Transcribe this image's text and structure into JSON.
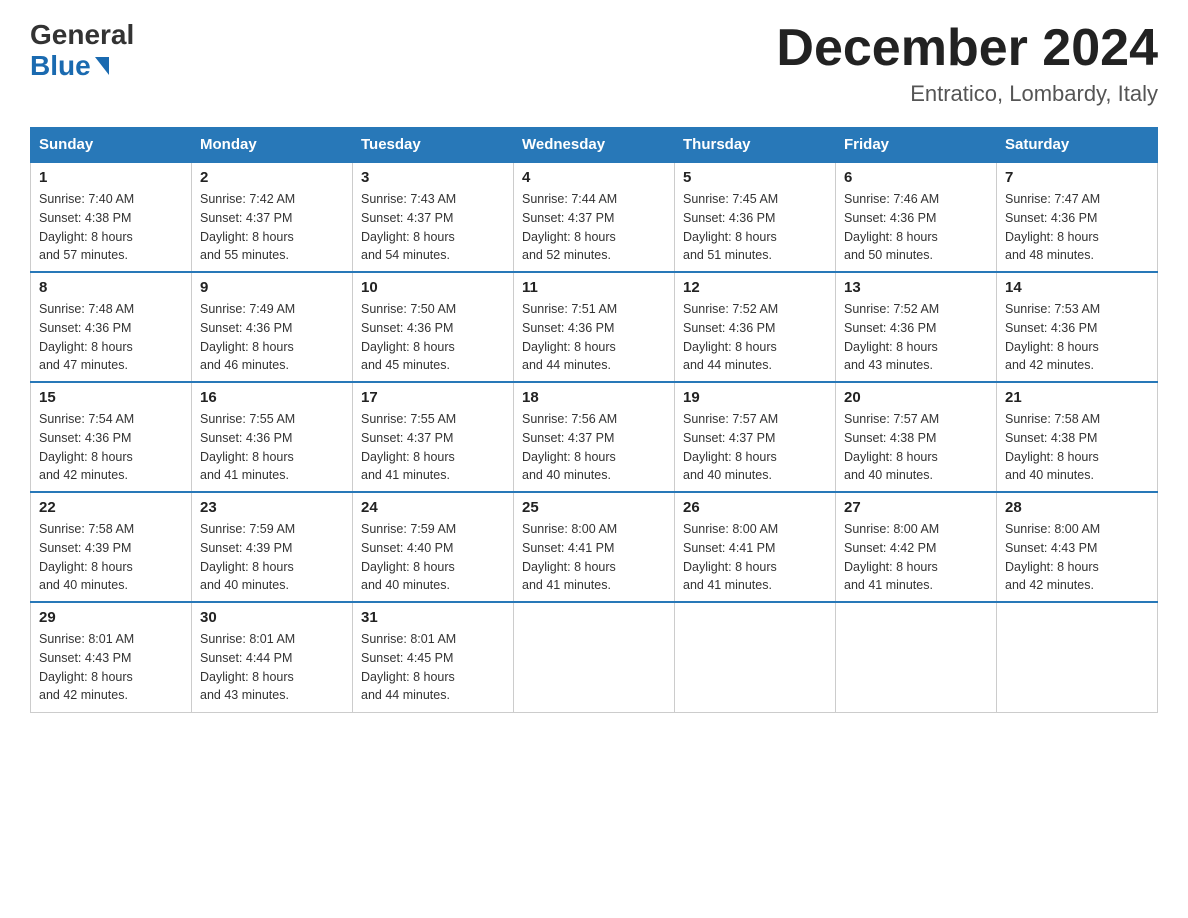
{
  "header": {
    "logo_general": "General",
    "logo_blue": "Blue",
    "month_title": "December 2024",
    "location": "Entratico, Lombardy, Italy"
  },
  "days_of_week": [
    "Sunday",
    "Monday",
    "Tuesday",
    "Wednesday",
    "Thursday",
    "Friday",
    "Saturday"
  ],
  "weeks": [
    [
      {
        "day": "1",
        "sunrise": "7:40 AM",
        "sunset": "4:38 PM",
        "daylight": "8 hours and 57 minutes."
      },
      {
        "day": "2",
        "sunrise": "7:42 AM",
        "sunset": "4:37 PM",
        "daylight": "8 hours and 55 minutes."
      },
      {
        "day": "3",
        "sunrise": "7:43 AM",
        "sunset": "4:37 PM",
        "daylight": "8 hours and 54 minutes."
      },
      {
        "day": "4",
        "sunrise": "7:44 AM",
        "sunset": "4:37 PM",
        "daylight": "8 hours and 52 minutes."
      },
      {
        "day": "5",
        "sunrise": "7:45 AM",
        "sunset": "4:36 PM",
        "daylight": "8 hours and 51 minutes."
      },
      {
        "day": "6",
        "sunrise": "7:46 AM",
        "sunset": "4:36 PM",
        "daylight": "8 hours and 50 minutes."
      },
      {
        "day": "7",
        "sunrise": "7:47 AM",
        "sunset": "4:36 PM",
        "daylight": "8 hours and 48 minutes."
      }
    ],
    [
      {
        "day": "8",
        "sunrise": "7:48 AM",
        "sunset": "4:36 PM",
        "daylight": "8 hours and 47 minutes."
      },
      {
        "day": "9",
        "sunrise": "7:49 AM",
        "sunset": "4:36 PM",
        "daylight": "8 hours and 46 minutes."
      },
      {
        "day": "10",
        "sunrise": "7:50 AM",
        "sunset": "4:36 PM",
        "daylight": "8 hours and 45 minutes."
      },
      {
        "day": "11",
        "sunrise": "7:51 AM",
        "sunset": "4:36 PM",
        "daylight": "8 hours and 44 minutes."
      },
      {
        "day": "12",
        "sunrise": "7:52 AM",
        "sunset": "4:36 PM",
        "daylight": "8 hours and 44 minutes."
      },
      {
        "day": "13",
        "sunrise": "7:52 AM",
        "sunset": "4:36 PM",
        "daylight": "8 hours and 43 minutes."
      },
      {
        "day": "14",
        "sunrise": "7:53 AM",
        "sunset": "4:36 PM",
        "daylight": "8 hours and 42 minutes."
      }
    ],
    [
      {
        "day": "15",
        "sunrise": "7:54 AM",
        "sunset": "4:36 PM",
        "daylight": "8 hours and 42 minutes."
      },
      {
        "day": "16",
        "sunrise": "7:55 AM",
        "sunset": "4:36 PM",
        "daylight": "8 hours and 41 minutes."
      },
      {
        "day": "17",
        "sunrise": "7:55 AM",
        "sunset": "4:37 PM",
        "daylight": "8 hours and 41 minutes."
      },
      {
        "day": "18",
        "sunrise": "7:56 AM",
        "sunset": "4:37 PM",
        "daylight": "8 hours and 40 minutes."
      },
      {
        "day": "19",
        "sunrise": "7:57 AM",
        "sunset": "4:37 PM",
        "daylight": "8 hours and 40 minutes."
      },
      {
        "day": "20",
        "sunrise": "7:57 AM",
        "sunset": "4:38 PM",
        "daylight": "8 hours and 40 minutes."
      },
      {
        "day": "21",
        "sunrise": "7:58 AM",
        "sunset": "4:38 PM",
        "daylight": "8 hours and 40 minutes."
      }
    ],
    [
      {
        "day": "22",
        "sunrise": "7:58 AM",
        "sunset": "4:39 PM",
        "daylight": "8 hours and 40 minutes."
      },
      {
        "day": "23",
        "sunrise": "7:59 AM",
        "sunset": "4:39 PM",
        "daylight": "8 hours and 40 minutes."
      },
      {
        "day": "24",
        "sunrise": "7:59 AM",
        "sunset": "4:40 PM",
        "daylight": "8 hours and 40 minutes."
      },
      {
        "day": "25",
        "sunrise": "8:00 AM",
        "sunset": "4:41 PM",
        "daylight": "8 hours and 41 minutes."
      },
      {
        "day": "26",
        "sunrise": "8:00 AM",
        "sunset": "4:41 PM",
        "daylight": "8 hours and 41 minutes."
      },
      {
        "day": "27",
        "sunrise": "8:00 AM",
        "sunset": "4:42 PM",
        "daylight": "8 hours and 41 minutes."
      },
      {
        "day": "28",
        "sunrise": "8:00 AM",
        "sunset": "4:43 PM",
        "daylight": "8 hours and 42 minutes."
      }
    ],
    [
      {
        "day": "29",
        "sunrise": "8:01 AM",
        "sunset": "4:43 PM",
        "daylight": "8 hours and 42 minutes."
      },
      {
        "day": "30",
        "sunrise": "8:01 AM",
        "sunset": "4:44 PM",
        "daylight": "8 hours and 43 minutes."
      },
      {
        "day": "31",
        "sunrise": "8:01 AM",
        "sunset": "4:45 PM",
        "daylight": "8 hours and 44 minutes."
      },
      null,
      null,
      null,
      null
    ]
  ],
  "labels": {
    "sunrise": "Sunrise:",
    "sunset": "Sunset:",
    "daylight": "Daylight:"
  }
}
